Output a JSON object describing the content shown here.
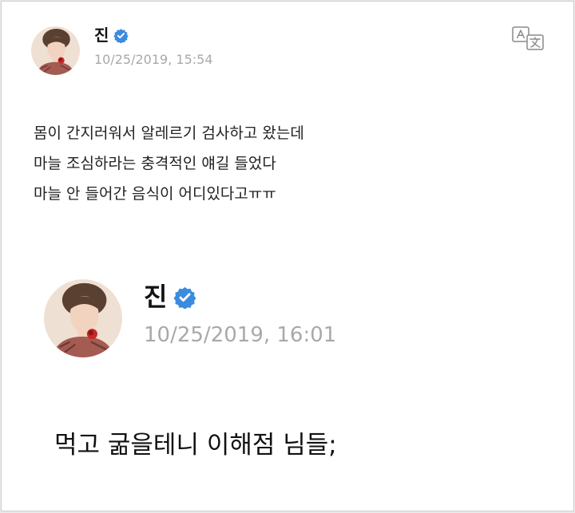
{
  "colors": {
    "verified_badge": "#3b8be0",
    "timestamp_gray": "#a9a9a9",
    "text_dark": "#222222",
    "background": "#ffffff"
  },
  "post1": {
    "author_name": "진",
    "verified_icon": "verified-badge-icon",
    "timestamp": "10/25/2019, 15:54",
    "translate_icon": "translate-icon",
    "lines": [
      "몸이 간지러워서 알레르기 검사하고 왔는데",
      "마늘 조심하라는 충격적인 얘길 들었다",
      "마늘 안 들어간 음식이 어디있다고ㅠㅠ"
    ]
  },
  "post2": {
    "author_name": "진",
    "verified_icon": "verified-badge-icon",
    "timestamp": "10/25/2019, 16:01",
    "text": "먹고 굶을테니 이해점 님들;"
  }
}
